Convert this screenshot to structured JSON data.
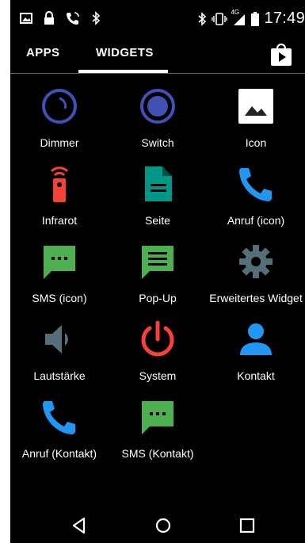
{
  "status_bar": {
    "time": "17:49",
    "network_label": "4G",
    "icons": [
      "image-icon",
      "lock-icon",
      "phone-call-icon",
      "bluetooth-icon",
      "bluetooth-icon",
      "vibrate-icon",
      "signal-icon",
      "battery-icon"
    ]
  },
  "tabs": {
    "apps_label": "APPS",
    "widgets_label": "WIDGETS",
    "active": "WIDGETS",
    "store_icon": "play-store-icon"
  },
  "widgets": [
    {
      "label": "Dimmer",
      "icon": "dimmer-icon",
      "color": "#3f51b5"
    },
    {
      "label": "Switch",
      "icon": "switch-icon",
      "color": "#3f51b5"
    },
    {
      "label": "Icon",
      "icon": "image-icon",
      "color": "#ffffff"
    },
    {
      "label": "Infrarot",
      "icon": "remote-icon",
      "color": "#f44336"
    },
    {
      "label": "Seite",
      "icon": "document-icon",
      "color": "#009688"
    },
    {
      "label": "Anruf (icon)",
      "icon": "phone-icon",
      "color": "#2196f3"
    },
    {
      "label": "SMS (icon)",
      "icon": "sms-icon",
      "color": "#4caf50"
    },
    {
      "label": "Pop-Up",
      "icon": "message-icon",
      "color": "#4caf50"
    },
    {
      "label": "Erweitertes Widget",
      "icon": "gear-icon",
      "color": "#546e7a"
    },
    {
      "label": "Lautstärke",
      "icon": "speaker-icon",
      "color": "#546e7a"
    },
    {
      "label": "System",
      "icon": "power-icon",
      "color": "#f44336"
    },
    {
      "label": "Kontakt",
      "icon": "person-icon",
      "color": "#2196f3"
    },
    {
      "label": "Anruf (Kontakt)",
      "icon": "phone-icon",
      "color": "#2196f3"
    },
    {
      "label": "SMS (Kontakt)",
      "icon": "sms-icon",
      "color": "#4caf50"
    }
  ],
  "nav_bar": {
    "back_icon": "back-icon",
    "home_icon": "home-icon",
    "recents_icon": "recents-icon"
  }
}
